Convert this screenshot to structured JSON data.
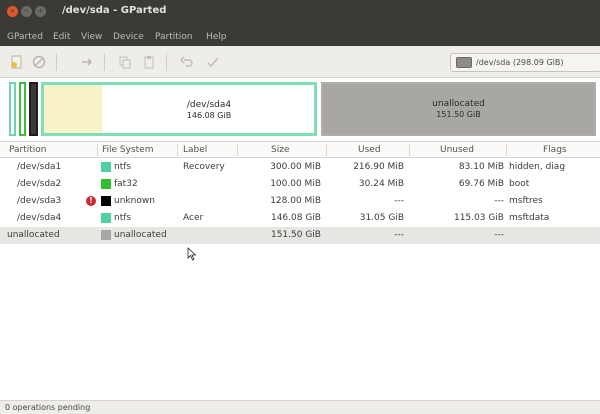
{
  "window": {
    "title": "/dev/sda - GParted"
  },
  "menu": [
    "GParted",
    "Edit",
    "View",
    "Device",
    "Partition",
    "Help"
  ],
  "device_selector": {
    "label": "/dev/sda  (298.09 GiB)"
  },
  "disk_map": {
    "sda4": {
      "name": "/dev/sda4",
      "size": "146.08 GiB"
    },
    "unallocated": {
      "name": "unallocated",
      "size": "151.50 GiB"
    }
  },
  "table": {
    "headers": [
      "Partition",
      "File System",
      "Label",
      "Size",
      "Used",
      "Unused",
      "Flags"
    ],
    "rows": [
      {
        "partition": "/dev/sda1",
        "fs": "ntfs",
        "fs_color": "#4fd1a0",
        "label": "Recovery",
        "size": "300.00 MiB",
        "used": "216.90 MiB",
        "unused": "83.10 MiB",
        "flags": "hidden, diag"
      },
      {
        "partition": "/dev/sda2",
        "fs": "fat32",
        "fs_color": "#2fbf2f",
        "label": "",
        "size": "100.00 MiB",
        "used": "30.24 MiB",
        "unused": "69.76 MiB",
        "flags": "boot"
      },
      {
        "partition": "/dev/sda3",
        "fs": "unknown",
        "fs_color": "#000000",
        "label": "",
        "size": "128.00 MiB",
        "used": "---",
        "unused": "---",
        "flags": "msftres"
      },
      {
        "partition": "/dev/sda4",
        "fs": "ntfs",
        "fs_color": "#4fd1a0",
        "label": "Acer",
        "size": "146.08 GiB",
        "used": "31.05 GiB",
        "unused": "115.03 GiB",
        "flags": "msftdata"
      },
      {
        "partition": "unallocated",
        "fs": "unallocated",
        "fs_color": "#a9a7a4",
        "label": "",
        "size": "151.50 GiB",
        "used": "---",
        "unused": "---",
        "flags": ""
      }
    ]
  },
  "status": {
    "text": "0 operations pending"
  },
  "icons": {
    "new": "new-partition-icon",
    "delete": "delete-icon",
    "resize": "resize-move-icon",
    "copy": "copy-icon",
    "paste": "paste-icon",
    "undo": "undo-icon",
    "apply": "apply-icon",
    "warning": "warning-icon",
    "disk": "hard-disk-icon"
  },
  "colors": {
    "titlebar": "#3b3a36",
    "close_button": "#e0572d",
    "ntfs": "#4fd1a0",
    "fat32": "#2fbf2f"
  }
}
